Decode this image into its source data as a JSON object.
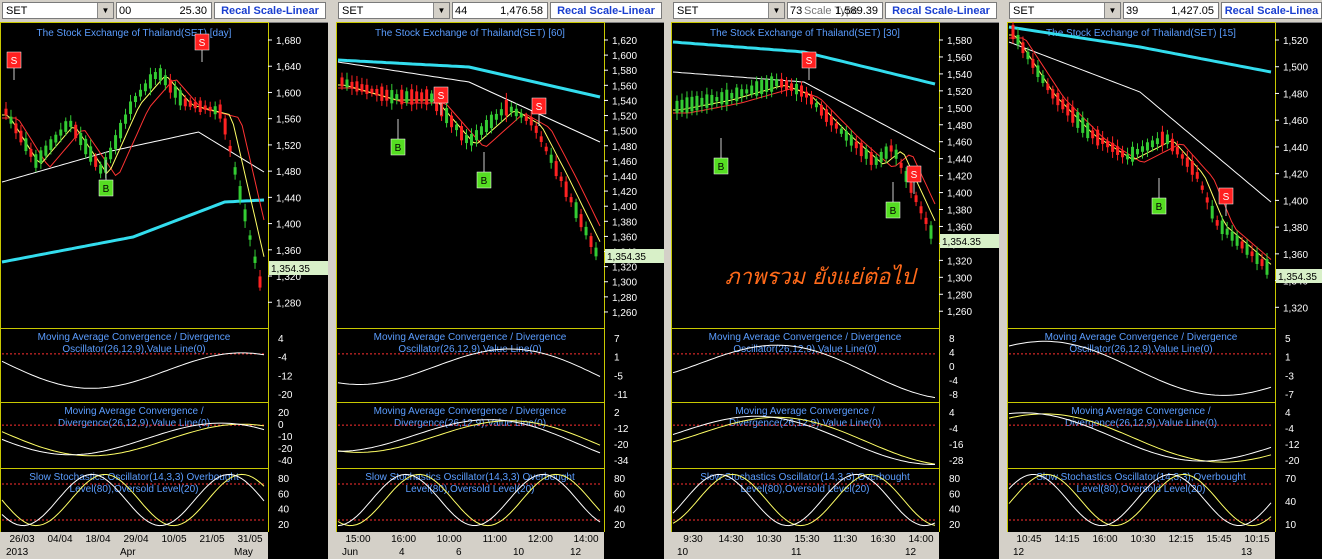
{
  "panels": [
    {
      "symbol": "SET",
      "value_prefix": "00",
      "price": "25.30",
      "recal_label": "Recal Scale-Linear",
      "title": "The Stock Exchange of Thailand(SET) [day]",
      "y_ticks": [
        "1,680",
        "1,640",
        "1,600",
        "1,560",
        "1,520",
        "1,480",
        "1,440",
        "1,400",
        "1,360",
        "1,320",
        "1,280"
      ],
      "last_price": "1,354.35",
      "macd1_title": [
        "Moving Average Convergence / Divergence",
        "Oscillator(26,12,9),Value Line(0)"
      ],
      "macd1_ticks": [
        "4",
        "-4",
        "-12",
        "-20"
      ],
      "macd2_title": [
        "Moving Average Convergence /",
        "Divergence(26,12,9),Value Line(0)"
      ],
      "macd2_ticks": [
        "20",
        "0",
        "-10",
        "-20",
        "-40"
      ],
      "stoch_title": [
        "Slow Stochastics Oscillator(14,3,3) Overbought",
        "Level(80),Oversold Level(20)"
      ],
      "stoch_ticks": [
        "80",
        "60",
        "40",
        "20"
      ],
      "dates": [
        "26/03",
        "04/04",
        "18/04",
        "29/04",
        "10/05",
        "21/05",
        "31/05"
      ],
      "periods": [
        "2013",
        "Apr",
        "May"
      ]
    },
    {
      "symbol": "SET",
      "value_prefix": "44",
      "price": "1,476.58",
      "recal_label": "Recal Scale-Linear",
      "title": "The Stock Exchange of Thailand(SET) [60]",
      "y_ticks": [
        "1,620",
        "1,600",
        "1,580",
        "1,560",
        "1,540",
        "1,520",
        "1,500",
        "1,480",
        "1,460",
        "1,440",
        "1,420",
        "1,400",
        "1,380",
        "1,360",
        "1,340",
        "1,320",
        "1,300",
        "1,280",
        "1,260"
      ],
      "last_price": "1,354.35",
      "macd1_title": [
        "Moving Average Convergence / Divergence",
        "Oscillator(26,12,9),Value Line(0)"
      ],
      "macd1_ticks": [
        "7",
        "1",
        "-5",
        "-11"
      ],
      "macd2_title": [
        "Moving Average Convergence / Divergence",
        "Divergence(26,12,9),Value Line(0)"
      ],
      "macd2_ticks": [
        "2",
        "-12",
        "-20",
        "-34"
      ],
      "stoch_title": [
        "Slow Stochastics Oscillator(14,3,3) Overbought",
        "Level(80),Oversold Level(20)"
      ],
      "stoch_ticks": [
        "80",
        "60",
        "40",
        "20"
      ],
      "dates": [
        "15:00",
        "16:00",
        "10:00",
        "11:00",
        "12:00",
        "14:00"
      ],
      "periods": [
        "Jun",
        "4",
        "6",
        "10",
        "12"
      ]
    },
    {
      "symbol": "SET",
      "value_prefix": "73",
      "price": "1,589.39",
      "recal_label": "Recal Scale-Linear",
      "overlay_label": "Scale Type",
      "title": "The Stock Exchange of Thailand(SET) [30]",
      "y_ticks": [
        "1,580",
        "1,560",
        "1,540",
        "1,520",
        "1,500",
        "1,480",
        "1,460",
        "1,440",
        "1,420",
        "1,400",
        "1,380",
        "1,360",
        "1,340",
        "1,320",
        "1,300",
        "1,280",
        "1,260"
      ],
      "last_price": "1,354.35",
      "watermark": "ภาพรวม ยังแย่ต่อไป",
      "macd1_title": [
        "Moving Average Convergence / Divergence",
        "Oscillator(26,12,9),Value Line(0)"
      ],
      "macd1_ticks": [
        "8",
        "4",
        "0",
        "-4",
        "-8"
      ],
      "macd2_title": [
        "Moving Average Convergence /",
        "Divergence(26,12,9),Value Line(0)"
      ],
      "macd2_ticks": [
        "4",
        "-4",
        "-16",
        "-28"
      ],
      "stoch_title": [
        "Slow Stochastics Oscillator(14,3,3),Overbought",
        "Level(80),Oversold Level(20)"
      ],
      "stoch_ticks": [
        "80",
        "60",
        "40",
        "20"
      ],
      "dates": [
        "9:30",
        "14:30",
        "10:30",
        "15:30",
        "11:30",
        "16:30",
        "14:00"
      ],
      "periods": [
        "10",
        "11",
        "12"
      ]
    },
    {
      "symbol": "SET",
      "value_prefix": "39",
      "price": "1,427.05",
      "recal_label": "Recal Scale-Linea",
      "title": "The Stock Exchange of Thailand(SET) [15]",
      "y_ticks": [
        "1,520",
        "1,500",
        "1,480",
        "1,460",
        "1,440",
        "1,420",
        "1,400",
        "1,380",
        "1,360",
        "1,340",
        "1,320"
      ],
      "last_price": "1,354.35",
      "macd1_title": [
        "Moving Average Convergence / Divergence",
        "Oscillator(26,12,9),Value Line(0)"
      ],
      "macd1_ticks": [
        "5",
        "1",
        "-3",
        "-7"
      ],
      "macd2_title": [
        "Moving Average Convergence /",
        "Divergence(26,12,9),Value Line(0)"
      ],
      "macd2_ticks": [
        "4",
        "-4",
        "-12",
        "-20"
      ],
      "stoch_title": [
        "Slow Stochastics Oscillator(14,3,3),Overbought",
        "Level(80),Oversold Level(20)"
      ],
      "stoch_ticks": [
        "70",
        "40",
        "10"
      ],
      "dates": [
        "10:45",
        "14:15",
        "16:00",
        "10:30",
        "12:15",
        "15:45",
        "10:15"
      ],
      "periods": [
        "12",
        "13"
      ]
    }
  ],
  "signal_labels": {
    "sell": "S",
    "buy": "B"
  },
  "colors": {
    "background": "#000000",
    "candle_up": "#33cc33",
    "candle_down": "#ff2222",
    "ma_fast": "#ffff66",
    "ma_mid": "#ff3333",
    "ma_slow": "#ffffff",
    "ma_long": "#33ddee",
    "title": "#5b9dff",
    "frame": "#c8c800",
    "last_price_bg": "#d8f0c8",
    "watermark": "#ff6a1a"
  }
}
